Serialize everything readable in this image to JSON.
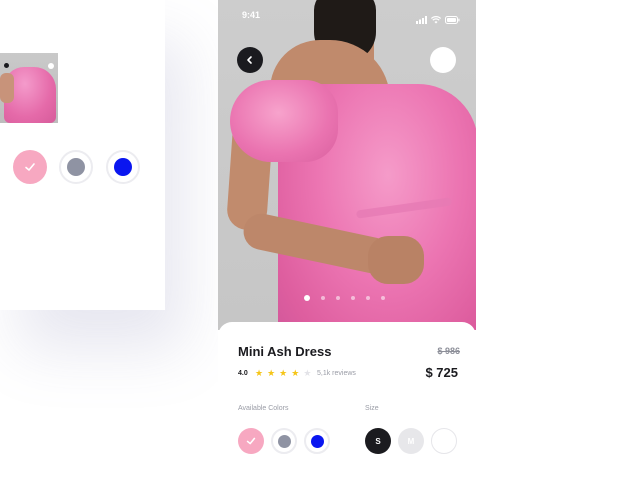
{
  "background_card": {
    "colors": [
      {
        "name": "pink",
        "hex": "#f7a8c1",
        "selected": true
      },
      {
        "name": "gray",
        "hex": "#8f93a3",
        "selected": false
      },
      {
        "name": "blue",
        "hex": "#0a16f0",
        "selected": false
      }
    ]
  },
  "status_bar": {
    "time": "9:41"
  },
  "product": {
    "name": "Mini Ash Dress",
    "old_price": "$ 986",
    "price": "$ 725",
    "rating": "4.0",
    "stars": 4,
    "max_stars": 5,
    "reviews": "5,1k reviews",
    "star_color": "#f5c518"
  },
  "carousel": {
    "count": 6,
    "active_index": 0
  },
  "options": {
    "colors_label": "Available Colors",
    "size_label": "Size",
    "colors": [
      {
        "name": "pink",
        "hex": "#f7a8c1",
        "selected": true
      },
      {
        "name": "gray",
        "hex": "#8f93a3",
        "selected": false
      },
      {
        "name": "blue",
        "hex": "#0a16f0",
        "selected": false
      }
    ],
    "sizes": [
      {
        "label": "S",
        "selected": true
      },
      {
        "label": "M",
        "selected": false
      },
      {
        "label": "L",
        "selected": false
      }
    ]
  }
}
